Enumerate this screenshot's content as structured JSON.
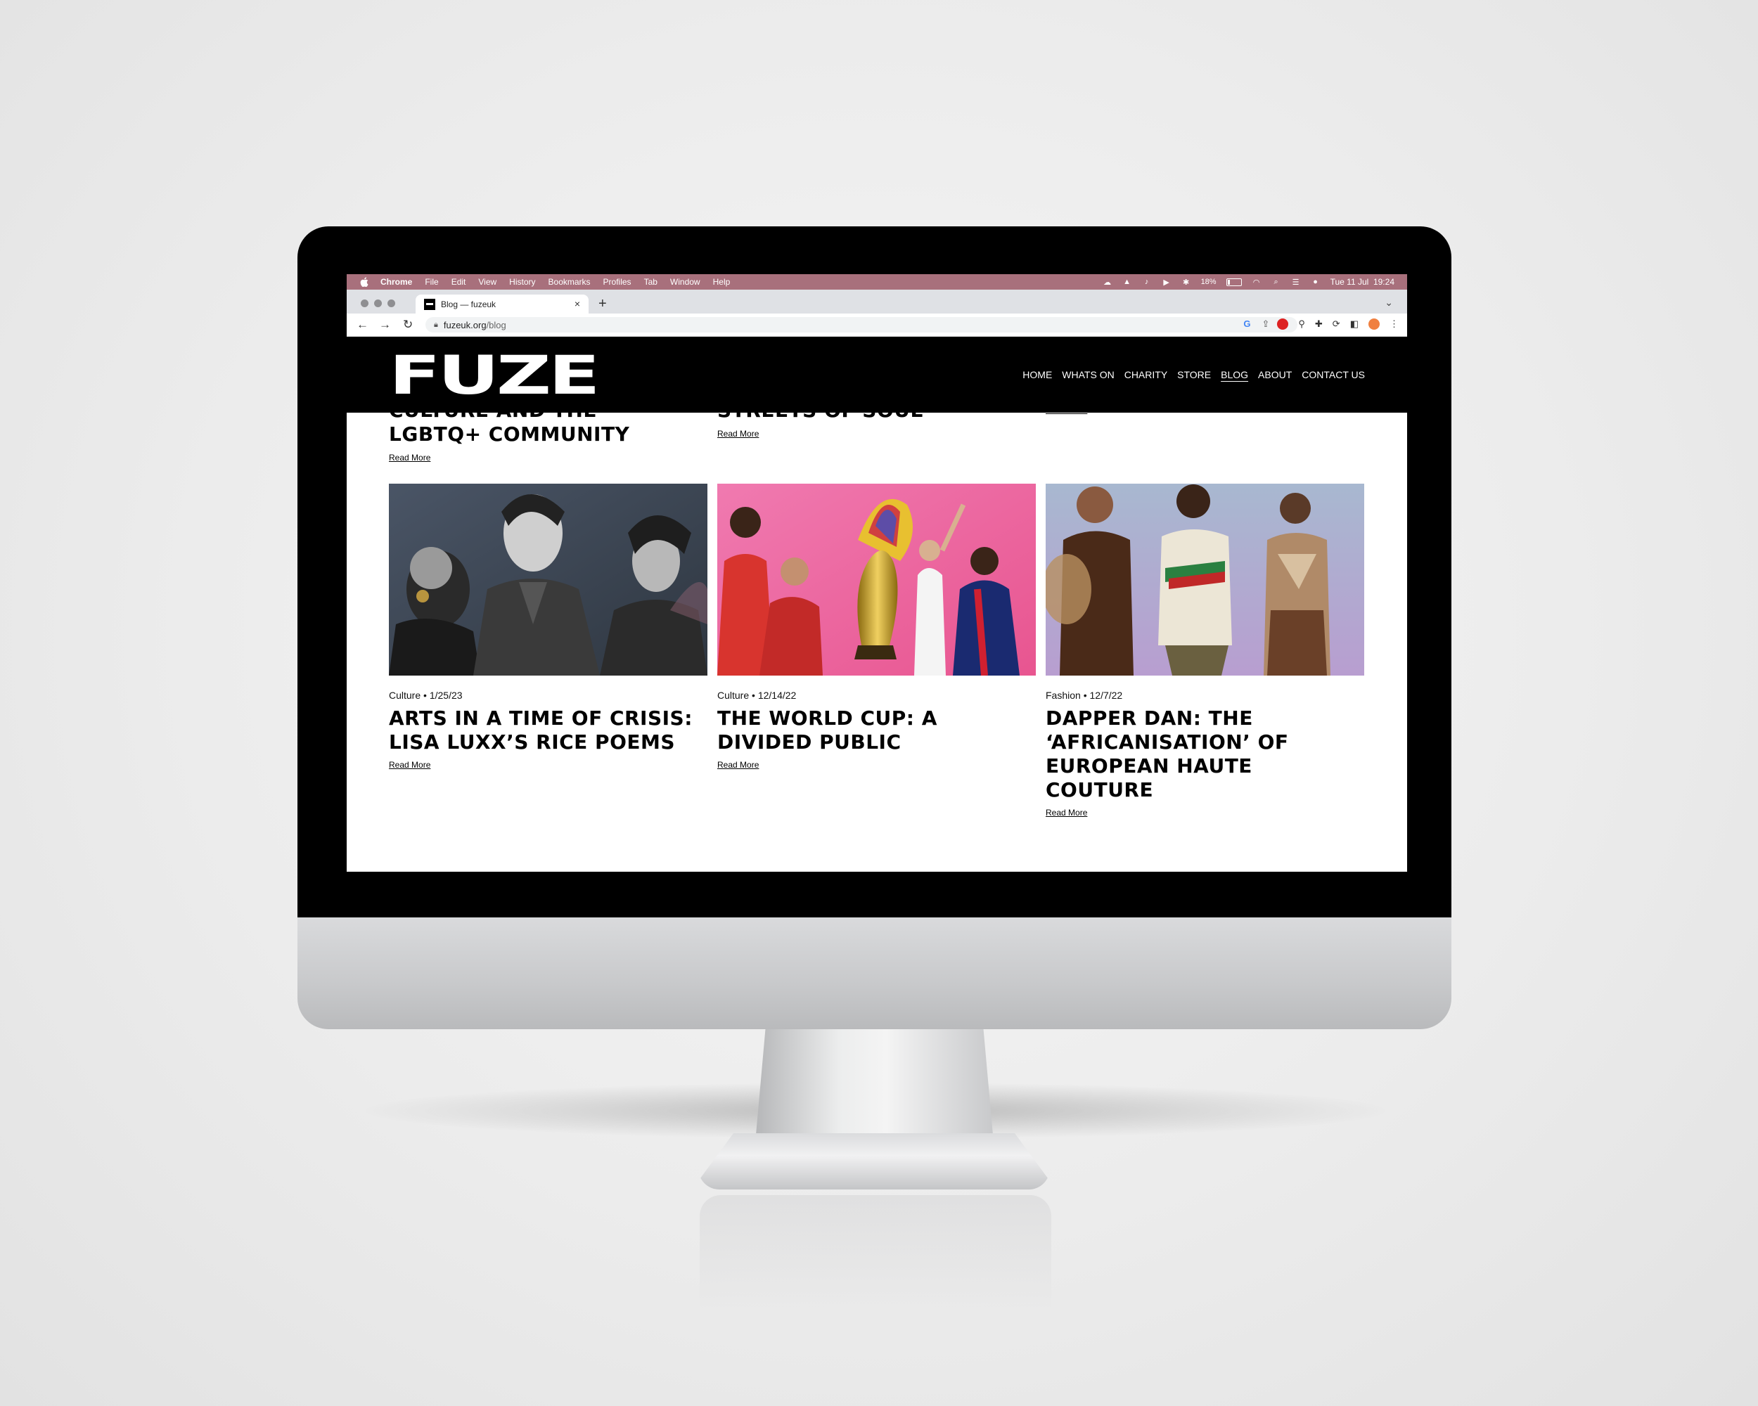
{
  "menubar": {
    "items": [
      "Chrome",
      "File",
      "Edit",
      "View",
      "History",
      "Bookmarks",
      "Profiles",
      "Tab",
      "Window",
      "Help"
    ],
    "battery": "18%",
    "datetime": "Tue 11 Jul  19:24"
  },
  "browser": {
    "tab_title": "Blog — fuzeuk",
    "tab_close": "×",
    "new_tab": "+",
    "url_host": "fuzeuk.org",
    "url_path": "/blog"
  },
  "site": {
    "logo": "FUZE",
    "nav": [
      {
        "label": "HOME"
      },
      {
        "label": "WHATS ON"
      },
      {
        "label": "CHARITY"
      },
      {
        "label": "STORE"
      },
      {
        "label": "BLOG",
        "active": true
      },
      {
        "label": "ABOUT"
      },
      {
        "label": "CONTACT US"
      }
    ]
  },
  "partial_posts": [
    {
      "title_line1": "CULTURE AND THE",
      "title_line2": "LGBTQ+ COMMUNITY",
      "read_more": "Read More"
    },
    {
      "title_line1": "STREETS OF SOUL",
      "read_more": "Read More"
    },
    {
      "read_more": "Read More"
    }
  ],
  "posts": [
    {
      "category": "Culture",
      "date": "1/25/23",
      "title": "ARTS IN A TIME OF CRISIS: LISA LUXX’S RICE POEMS",
      "read_more": "Read More"
    },
    {
      "category": "Culture",
      "date": "12/14/22",
      "title": "THE WORLD CUP: A DIVIDED PUBLIC",
      "read_more": "Read More"
    },
    {
      "category": "Fashion",
      "date": "12/7/22",
      "title": "DAPPER DAN: THE ‘AFRICANISATION’ OF EUROPEAN HAUTE COUTURE",
      "read_more": "Read More"
    }
  ]
}
